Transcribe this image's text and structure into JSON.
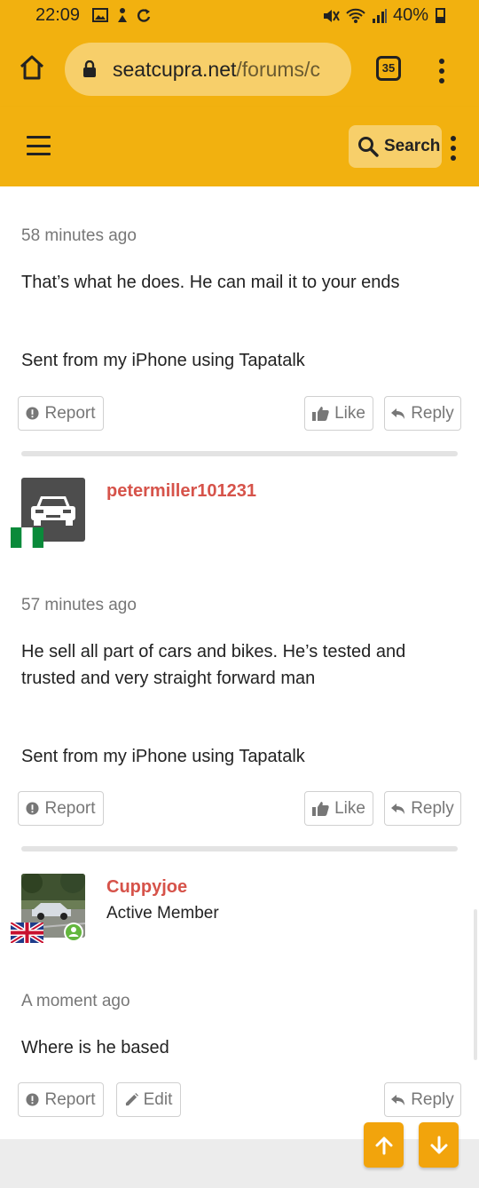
{
  "status_bar": {
    "time": "22:09",
    "battery": "40%",
    "icons": [
      "gallery-icon",
      "activity-icon",
      "sync-icon",
      "mute-icon",
      "wifi-icon",
      "signal-icon",
      "battery-icon"
    ]
  },
  "browser": {
    "url_domain": "seatcupra.net",
    "url_path": "/forums/c",
    "tab_count": "35"
  },
  "site_header": {
    "search_label": "Search"
  },
  "posts": [
    {
      "time": "58 minutes ago",
      "message": "That’s what he does. He can mail it to your ends",
      "signature": "Sent from my iPhone using Tapatalk",
      "actions": {
        "report": "Report",
        "like": "Like",
        "reply": "Reply"
      }
    },
    {
      "username": "petermiller101231",
      "flag": "Nigeria",
      "time": "57 minutes ago",
      "message": "He sell all part of cars and bikes. He’s tested and trusted and very straight forward man",
      "signature": "Sent from my iPhone using Tapatalk",
      "actions": {
        "report": "Report",
        "like": "Like",
        "reply": "Reply"
      }
    },
    {
      "username": "Cuppyjoe",
      "user_title": "Active Member",
      "flag": "United Kingdom",
      "online": true,
      "time": "A moment ago",
      "message": "Where is he based",
      "actions": {
        "report": "Report",
        "edit": "Edit",
        "reply": "Reply"
      }
    }
  ],
  "colors": {
    "brand_yellow": "#f2b10f",
    "username_red": "#d6534a",
    "fab_orange": "#f2a40c"
  }
}
